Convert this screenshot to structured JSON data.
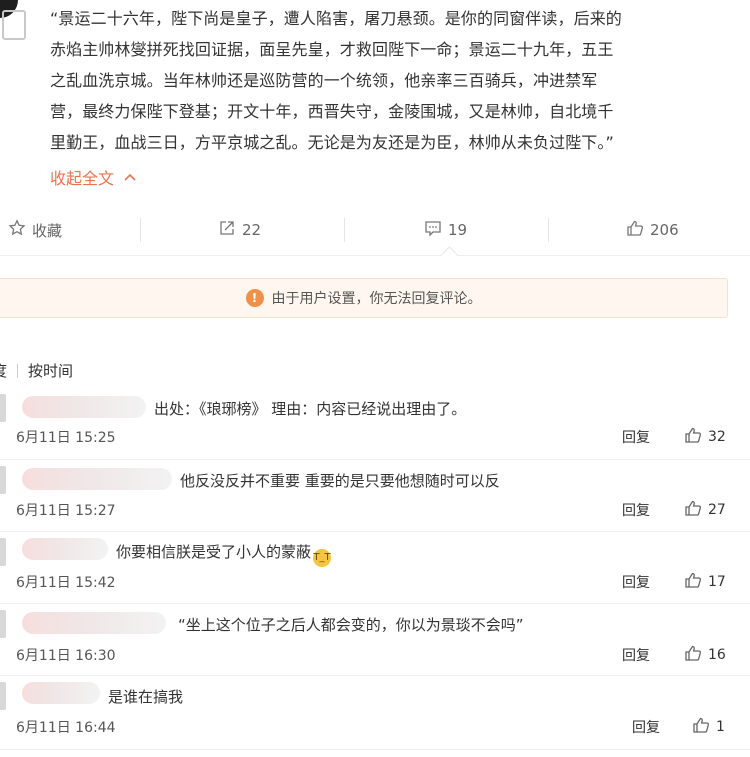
{
  "post": {
    "lines": [
      "“景运二十六年，陛下尚是皇子，遭人陷害，屠刀悬颈。是你的同窗伴读，后来的",
      "赤焰主帅林燮拼死找回证据，面呈先皇，才救回陛下一命；景运二十九年，五王",
      "之乱血洗京城。当年林帅还是巡防营的一个统领，他亲率三百骑兵，冲进禁军",
      "营，最终力保陛下登基；开文十年，西晋失守，金陵围城，又是林帅，自北境千",
      "里勤王，血战三日，方平京城之乱。无论是为友还是为臣，林帅从未负过陛下。”"
    ],
    "collapse_label": "收起全文",
    "collapse_icon": "chevron-up"
  },
  "actions": {
    "favorite_label": "收藏",
    "repost_count": "22",
    "comment_count": "19",
    "like_count": "206"
  },
  "notice": {
    "text": "由于用户设置，你无法回复评论。"
  },
  "sort": {
    "partial_label": "度",
    "by_time_label": "按时间"
  },
  "comments": [
    {
      "text": "出处：《琅琊榜》 理由：内容已经说出理由了。",
      "time": "6月11日 15:25",
      "reply": "回复",
      "likes": "32"
    },
    {
      "text": "他反没反并不重要 重要的是只要他想随时可以反",
      "time": "6月11日 15:27",
      "reply": "回复",
      "likes": "27"
    },
    {
      "text": "你要相信朕是受了小人的蒙蔽",
      "time": "6月11日 15:42",
      "reply": "回复",
      "likes": "17",
      "emoji": "crying-face"
    },
    {
      "text": "“坐上这个位子之后人都会变的，你以为景琰不会吗”",
      "time": "6月11日 16:30",
      "reply": "回复",
      "likes": "16"
    },
    {
      "text": "是谁在搞我",
      "time": "6月11日 16:44",
      "reply": "回复",
      "likes": "1"
    }
  ],
  "colors": {
    "accent": "#eb7350",
    "notice_bg": "#fff7ef",
    "warn": "#f19149"
  }
}
